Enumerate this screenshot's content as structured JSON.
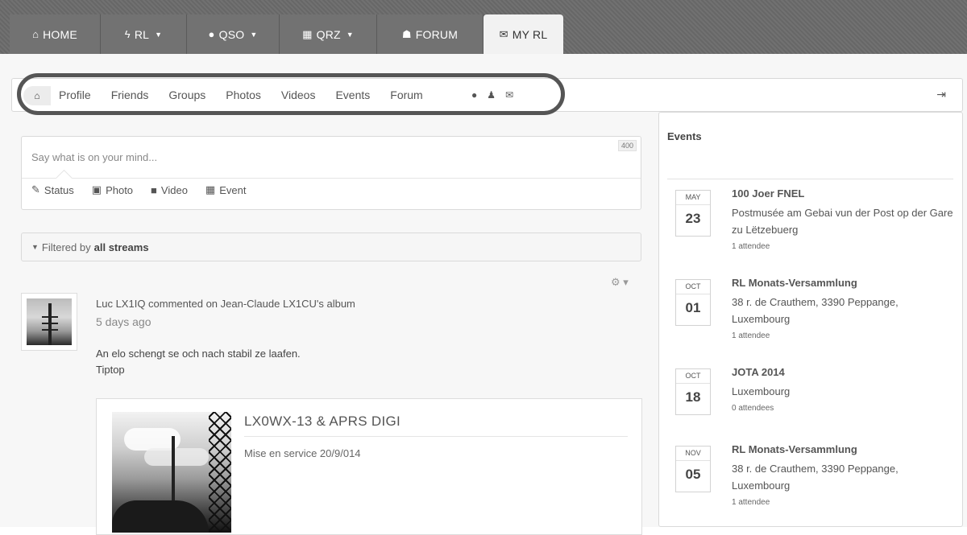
{
  "topnav": {
    "items": [
      {
        "icon": "home-icon",
        "glyph": "⌂",
        "label": "HOME",
        "caret": false,
        "active": false
      },
      {
        "icon": "bolt-icon",
        "glyph": "ϟ",
        "label": "RL",
        "caret": true,
        "active": false
      },
      {
        "icon": "globe-icon",
        "glyph": "●",
        "label": "QSO",
        "caret": true,
        "active": false
      },
      {
        "icon": "calendar-icon",
        "glyph": "▦",
        "label": "QRZ",
        "caret": true,
        "active": false
      },
      {
        "icon": "group-icon",
        "glyph": "☗",
        "label": "FORUM",
        "caret": false,
        "active": false
      },
      {
        "icon": "chat-icon",
        "glyph": "✉",
        "label": "MY RL",
        "caret": false,
        "active": true
      }
    ]
  },
  "subnav": {
    "links": [
      "Profile",
      "Friends",
      "Groups",
      "Photos",
      "Videos",
      "Events",
      "Forum"
    ],
    "icons": [
      "globe-icon",
      "user-icon",
      "envelope-icon"
    ]
  },
  "composer": {
    "placeholder": "Say what is on your mind...",
    "counter": "400",
    "tabs": [
      "Status",
      "Photo",
      "Video",
      "Event"
    ]
  },
  "filter": {
    "prefix": "Filtered by",
    "value": "all streams"
  },
  "post": {
    "meta": "Luc LX1IQ commented on Jean-Claude LX1CU's album",
    "time": "5 days ago",
    "body_line1": "An elo schengt se och nach stabil ze laafen.",
    "body_line2": "Tiptop",
    "album": {
      "title": "LX0WX-13 & APRS DIGI",
      "description": "Mise en service 20/9/014"
    }
  },
  "sidebar": {
    "heading": "Events",
    "events": [
      {
        "month": "MAY",
        "day": "23",
        "title": "100 Joer FNEL",
        "location": "Postmusée am Gebai vun der Post op der Gare zu Lëtzebuerg",
        "attendees": "1 attendee"
      },
      {
        "month": "OCT",
        "day": "01",
        "title": "RL Monats-Versammlung",
        "location": "38 r. de Crauthem, 3390 Peppange, Luxembourg",
        "attendees": "1 attendee"
      },
      {
        "month": "OCT",
        "day": "18",
        "title": "JOTA 2014",
        "location": "Luxembourg",
        "attendees": "0 attendees"
      },
      {
        "month": "NOV",
        "day": "05",
        "title": "RL Monats-Versammlung",
        "location": "38 r. de Crauthem, 3390 Peppange, Luxembourg",
        "attendees": "1 attendee"
      }
    ]
  }
}
